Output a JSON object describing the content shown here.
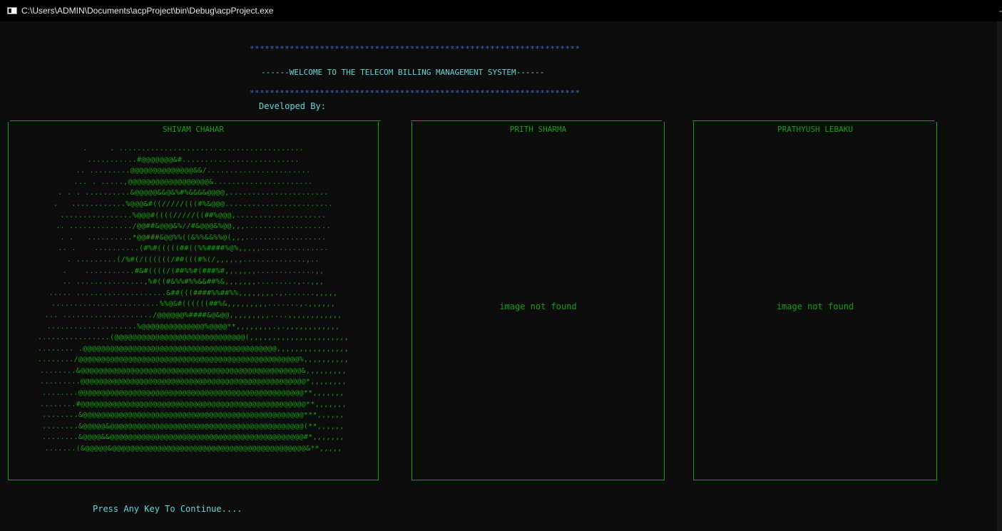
{
  "window": {
    "title": "C:\\Users\\ADMIN\\Documents\\acpProject\\bin\\Debug\\acpProject.exe",
    "corner_glyph": "-"
  },
  "header": {
    "stars_top": "******************************************************************",
    "welcome": "------WELCOME TO THE TELECOM BILLING MANAGEMENT SYSTEM------",
    "stars_bottom": "******************************************************************",
    "developed_by": "Developed By:"
  },
  "panels": [
    {
      "name": "SHIVAM CHAHAR",
      "ascii_art": [
        ".     . .........................................",
        "...........#@@@@@@@&#..........................",
        ".. .........@@@@@@@@@@@@@@&&/.......................",
        "... . .....,@@@@@@@@@@@@@@@@@@&......................",
        ". . . ..........&@@@@@&&@&%#%&&&&@@@@,......................",
        ".   ............%@@@&#((/////(((#%&@@@........................",
        "................%@@@#((((/////((##%@@@,....................",
        ".. ............../@@##&@@@&%//#&@@@&%@@,,,...................",
        ". .   ..........*@@###&@@%%((&%%&&%%@(,,,..................",
        ".. .    ..........(#%#(((((##((%%####%@%,,,,,...............",
        ". .........(/%#(/((((((/##(((#%(/,,,,,,..............,..",
        ".    ...........#&#((((/(##%%#(###%#,,,,,,,.............,,",
        ".. ...............,%#((#&%%#%%&&##%&,,,,,,,.........,..,,,",
        "..... ....................&##(((####%%##%%,,,,,,,,.,.......,,,,,",
        "........................%%@&#((((((##%&,,,,,,,,,.......,.,,,,,,",
        "... ..................../@@@@@@%####&@&@@,,,,,,,,,....,,,,,,,,,,,,",
        "....................%@@@@@@@@@@@@@@%@@@@**,,,,,,,,.,.,,,,,,,,,,,,",
        "................(@@@@@@@@@@@@@@@@@@@@@@@@@@@@@(,,,,,,,,,,,,,,,,,,,,,,",
        "........ .@@@@@@@@@@@@@@@@@@@@@@@@@@@@@@@@@@@@@@@@@@@,,,,,,,,,,,,,,,,",
        "......../@@@@@@@@@@@@@@@@@@@@@@@@@@@@@@@@@@@@@@@@@@@@@@@@@%,,,,,,,,,,",
        "........&@@@@@@@@@@@@@@@@@@@@@@@@@@@@@@@@@@@@@@@@@@@@@@@@@&,,,,,,,,,",
        ".........@@@@@@@@@@@@@@@@@@@@@@@@@@@@@@@@@@@@@@@@@@@@@@@@@@*,,,,,,,,",
        "........@@@@@@@@@@@@@@@@@@@@@@@@@@@@@@@@@@@@@@@@@@@@@@@@@@**,,,,,,,",
        "........#@@@@@@@@@@@@@@@@@@@@@@@@@@@@@@@@@@@@@@@@@@@@@@@@@@**,,,,,,,",
        "........&@@@@@@@@@@@@@@@@@@@@@@@@@@@@@@@@@@@@@@@@@@@@@@@@@***,,,,,,",
        "........&@@@@@&@@@@@@@@@@@@@@@@@@@@@@@@@@@@@@@@@@@@@@@@@@@(**,,,,,,",
        "........&@@@@&&@@@@@@@@@@@@@@@@@@@@@@@@@@@@@@@@@@@@@@@@@@@#*,,,,,,,",
        ".......(&@@@@@&@@@@@@@@@@@@@@@@@@@@@@@@@@@@@@@@@@@@@@@@@@@&**,,,,,"
      ]
    },
    {
      "name": "PRITH SHARMA",
      "message": "image not found"
    },
    {
      "name": "PRATHYUSH LEBAKU",
      "message": "image not found"
    }
  ],
  "footer": {
    "prompt": "Press Any Key To Continue...."
  },
  "colors": {
    "background": "#0c0c0c",
    "green": "#13a10e",
    "cyan": "#61d6d6",
    "blue": "#3a66c8"
  }
}
